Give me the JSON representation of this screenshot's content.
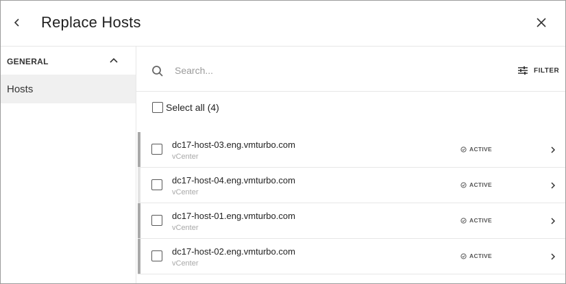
{
  "header": {
    "title": "Replace Hosts",
    "back_icon": "chevron-left-icon",
    "close_icon": "close-icon"
  },
  "sidebar": {
    "section_label": "GENERAL",
    "section_icon": "chevron-up-icon",
    "items": [
      {
        "label": "Hosts",
        "selected": true
      }
    ]
  },
  "search": {
    "placeholder": "Search...",
    "value": "",
    "icon": "search-icon"
  },
  "filter": {
    "label": "FILTER",
    "icon": "filter-sliders-icon"
  },
  "select_all": {
    "label": "Select all (4)",
    "checked": false
  },
  "hosts": [
    {
      "name": "dc17-host-03.eng.vmturbo.com",
      "type": "vCenter",
      "status": "ACTIVE",
      "checked": false
    },
    {
      "name": "dc17-host-04.eng.vmturbo.com",
      "type": "vCenter",
      "status": "ACTIVE",
      "checked": false
    },
    {
      "name": "dc17-host-01.eng.vmturbo.com",
      "type": "vCenter",
      "status": "ACTIVE",
      "checked": false
    },
    {
      "name": "dc17-host-02.eng.vmturbo.com",
      "type": "vCenter",
      "status": "ACTIVE",
      "checked": false
    }
  ],
  "colors": {
    "row_accent": "#a9a9a9",
    "row_accent_light": "#e3e3e3",
    "sidebar_selected_bg": "#f0f0f0",
    "muted_text": "#a8a8a8"
  }
}
